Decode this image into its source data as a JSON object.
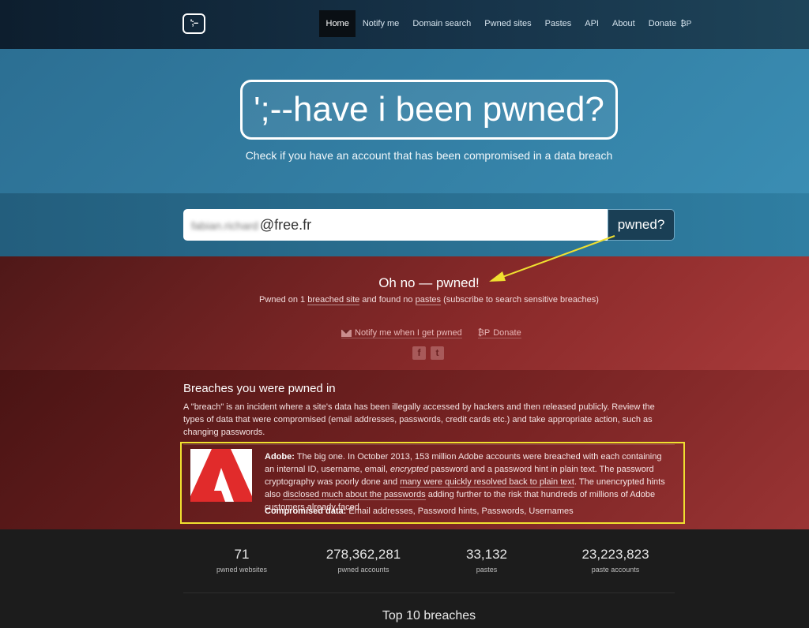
{
  "nav": {
    "logo_text": "';--",
    "items": [
      "Home",
      "Notify me",
      "Domain search",
      "Pwned sites",
      "Pastes",
      "API",
      "About"
    ],
    "donate_label": "Donate",
    "donate_glyph": "₿P"
  },
  "hero": {
    "title": "';--have i been pwned?",
    "tagline": "Check if you have an account that has been compromised in a data breach"
  },
  "search": {
    "blurred_part": "fabian.richard",
    "domain_part": "@free.fr",
    "button_label": "pwned?"
  },
  "result": {
    "title": "Oh no — pwned!",
    "sub_pre": "Pwned on 1 ",
    "sub_link1": "breached site",
    "sub_mid": " and found no ",
    "sub_link2": "pastes",
    "sub_post": " (subscribe to search sensitive breaches)",
    "notify_label": "Notify me when I get pwned",
    "donate_label": "Donate",
    "donate_glyph": "₿P"
  },
  "breaches": {
    "heading": "Breaches you were pwned in",
    "description": "A \"breach\" is an incident where a site's data has been illegally accessed by hackers and then released publicly. Review the types of data that were compromised (email addresses, passwords, credit cards etc.) and take appropriate action, such as changing passwords.",
    "card": {
      "name": "Adobe:",
      "text_1": " The big one. In October 2013, 153 million Adobe accounts were breached with each containing an internal ID, username, email, ",
      "text_em": "encrypted",
      "text_2": " password and a password hint in plain text. The password cryptography was poorly done and ",
      "link_1": "many were quickly resolved back to plain text",
      "text_3": ". The unencrypted hints also ",
      "link_2": "disclosed much about the passwords",
      "text_4": " adding further to the risk that hundreds of millions of Adobe customers already faced.",
      "compromised_label": "Compromised data:",
      "compromised_value": " Email addresses, Password hints, Passwords, Usernames"
    }
  },
  "stats": [
    {
      "value": "71",
      "label": "pwned websites"
    },
    {
      "value": "278,362,281",
      "label": "pwned accounts"
    },
    {
      "value": "33,132",
      "label": "pastes"
    },
    {
      "value": "23,223,823",
      "label": "paste accounts"
    }
  ],
  "top10_heading": "Top 10 breaches",
  "colors": {
    "annotation": "#f0e030",
    "adobe_red": "#e12b2b",
    "hero_blue": "#3a8db3",
    "pwned_red": "#8a2a2a"
  }
}
